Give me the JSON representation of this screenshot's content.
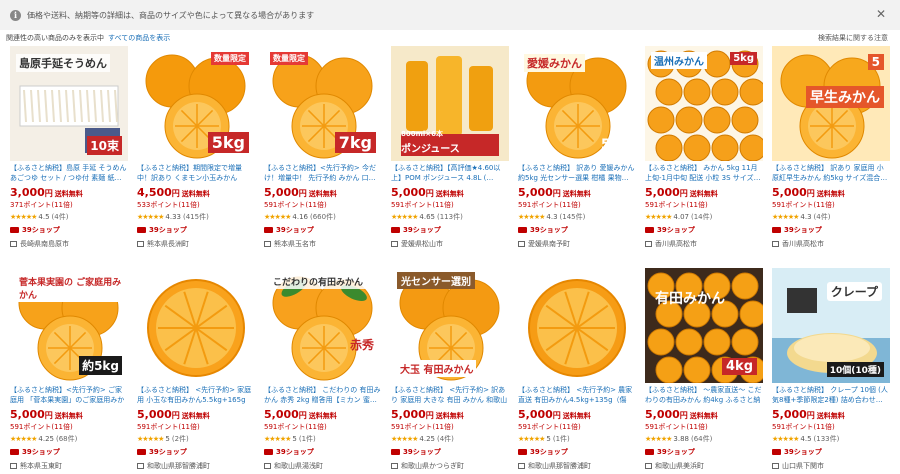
{
  "notice": {
    "text": "価格や送料、納期等の詳細は、商品のサイズや色によって異なる場合があります"
  },
  "filter": {
    "text": "関連性の高い商品のみを表示中",
    "link": "すべての商品を表示",
    "right": "検索結果に関する注意"
  },
  "common": {
    "ship": "送料無料",
    "badge": "39ショップ",
    "yen": "円"
  },
  "cards": [
    {
      "title": "【ふるさと納税】島原 手延 そうめん あごつゆ セット / つゆ付 素麺 紙…",
      "price": "3,000",
      "points": "371ポイント(11倍)",
      "score": "4.5",
      "reviews": "(4件)",
      "loc": "長崎県南島原市",
      "overlay": "島原手延そうめん",
      "overlay2": "10束"
    },
    {
      "title": "【ふるさと納税】期間限定で増量中！訳あり くまモン小玉みかん 5kg…",
      "price": "4,500",
      "points": "533ポイント(11倍)",
      "score": "4.33",
      "reviews": "(415件)",
      "loc": "熊本県長洲町",
      "overlay": "5kg",
      "overlay2": "数量限定"
    },
    {
      "title": "【ふるさと納税】<先行予約> 今だけ！増量中！ 先行予約 みかん 口…",
      "price": "5,000",
      "points": "591ポイント(11倍)",
      "score": "4.16",
      "reviews": "(660件)",
      "loc": "熊本県玉名市",
      "overlay": "7kg",
      "overlay2": "数量限定"
    },
    {
      "title": "【ふるさと納税】【高評価★4.60以上】POM ポンジュース 4.8L (…",
      "price": "5,000",
      "points": "591ポイント(11倍)",
      "score": "4.65",
      "reviews": "(113件)",
      "loc": "愛媛県松山市",
      "overlay": "ポンジュース",
      "overlay2": "800ml×6本"
    },
    {
      "title": "【ふるさと納税】 訳あり 愛媛みかん 約5kg 光センサー選果 柑橘 果物…",
      "price": "5,000",
      "points": "591ポイント(11倍)",
      "score": "4.3",
      "reviews": "(145件)",
      "loc": "愛媛県南予町",
      "overlay": "愛媛みかん",
      "overlay2": "5kg"
    },
    {
      "title": "【ふるさと納税】 みかん 5kg 11月上旬-1月中旬 配送 小粒 3S サイズ…",
      "price": "5,000",
      "points": "591ポイント(11倍)",
      "score": "4.07",
      "reviews": "(14件)",
      "loc": "香川県高松市",
      "overlay": "温州みかん",
      "overlay2": "5kg"
    },
    {
      "title": "【ふるさと納税】 訳あり 家庭用 小原紅早生みかん 約5kg サイズ混合…",
      "price": "5,000",
      "points": "591ポイント(11倍)",
      "score": "4.3",
      "reviews": "(4件)",
      "loc": "香川県高松市",
      "overlay": "早生みかん",
      "overlay2": "5"
    },
    {
      "title": "【ふるさと納税】<先行予約> ご家庭用 「菅本果実園」のご家庭用みかん★…",
      "price": "5,000",
      "points": "591ポイント(11倍)",
      "score": "4.25",
      "reviews": "(68件)",
      "loc": "熊本県玉東町",
      "overlay": "菅本果実園の ご家庭用みかん",
      "overlay2": "約5kg"
    },
    {
      "title": "【ふるさと納税】 <先行予約> 家庭用 小玉な有田みかん5.5kg+165g（傷み…",
      "price": "5,000",
      "points": "591ポイント(11倍)",
      "score": "5",
      "reviews": "(2件)",
      "loc": "和歌山県那智勝浦町",
      "overlay": "",
      "overlay2": ""
    },
    {
      "title": "【ふるさと納税】 こだわりの 有田みかん 赤秀 2kg 贈答用【ミカン 蜜…",
      "price": "5,000",
      "points": "591ポイント(11倍)",
      "score": "5",
      "reviews": "(1件)",
      "loc": "和歌山県湯浅町",
      "overlay": "こだわりの有田みかん",
      "overlay2": "赤秀"
    },
    {
      "title": "【ふるさと納税】 <先行予約> 訳あり 家庭用 大きな 有田 みかん 和歌山 6.5k…",
      "price": "5,000",
      "points": "591ポイント(11倍)",
      "score": "4.25",
      "reviews": "(4件)",
      "loc": "和歌山県かつらぎ町",
      "overlay": "光センサー選別",
      "overlay2": "大玉 有田みかん"
    },
    {
      "title": "【ふるさと納税】 <先行予約> 農家直送 有田みかん4.5kg+135g（傷み…",
      "price": "5,000",
      "points": "591ポイント(11倍)",
      "score": "5",
      "reviews": "(1件)",
      "loc": "和歌山県那智勝浦町",
      "overlay": "",
      "overlay2": ""
    },
    {
      "title": "【ふるさと納税】 ～農家直送～ こだわりの有田みかん 約4kg ふるさと納税…",
      "price": "5,000",
      "points": "591ポイント(11倍)",
      "score": "3.88",
      "reviews": "(64件)",
      "loc": "和歌山県美浜町",
      "overlay": "有田みかん",
      "overlay2": "4kg"
    },
    {
      "title": "【ふるさと納税】 クレープ 10個 (人気8種+季節限定2種) 詰め合わせ…",
      "price": "5,000",
      "points": "591ポイント(11倍)",
      "score": "4.5",
      "reviews": "(133件)",
      "loc": "山口県下関市",
      "overlay": "クレープ",
      "overlay2": "10個(10種)"
    }
  ]
}
